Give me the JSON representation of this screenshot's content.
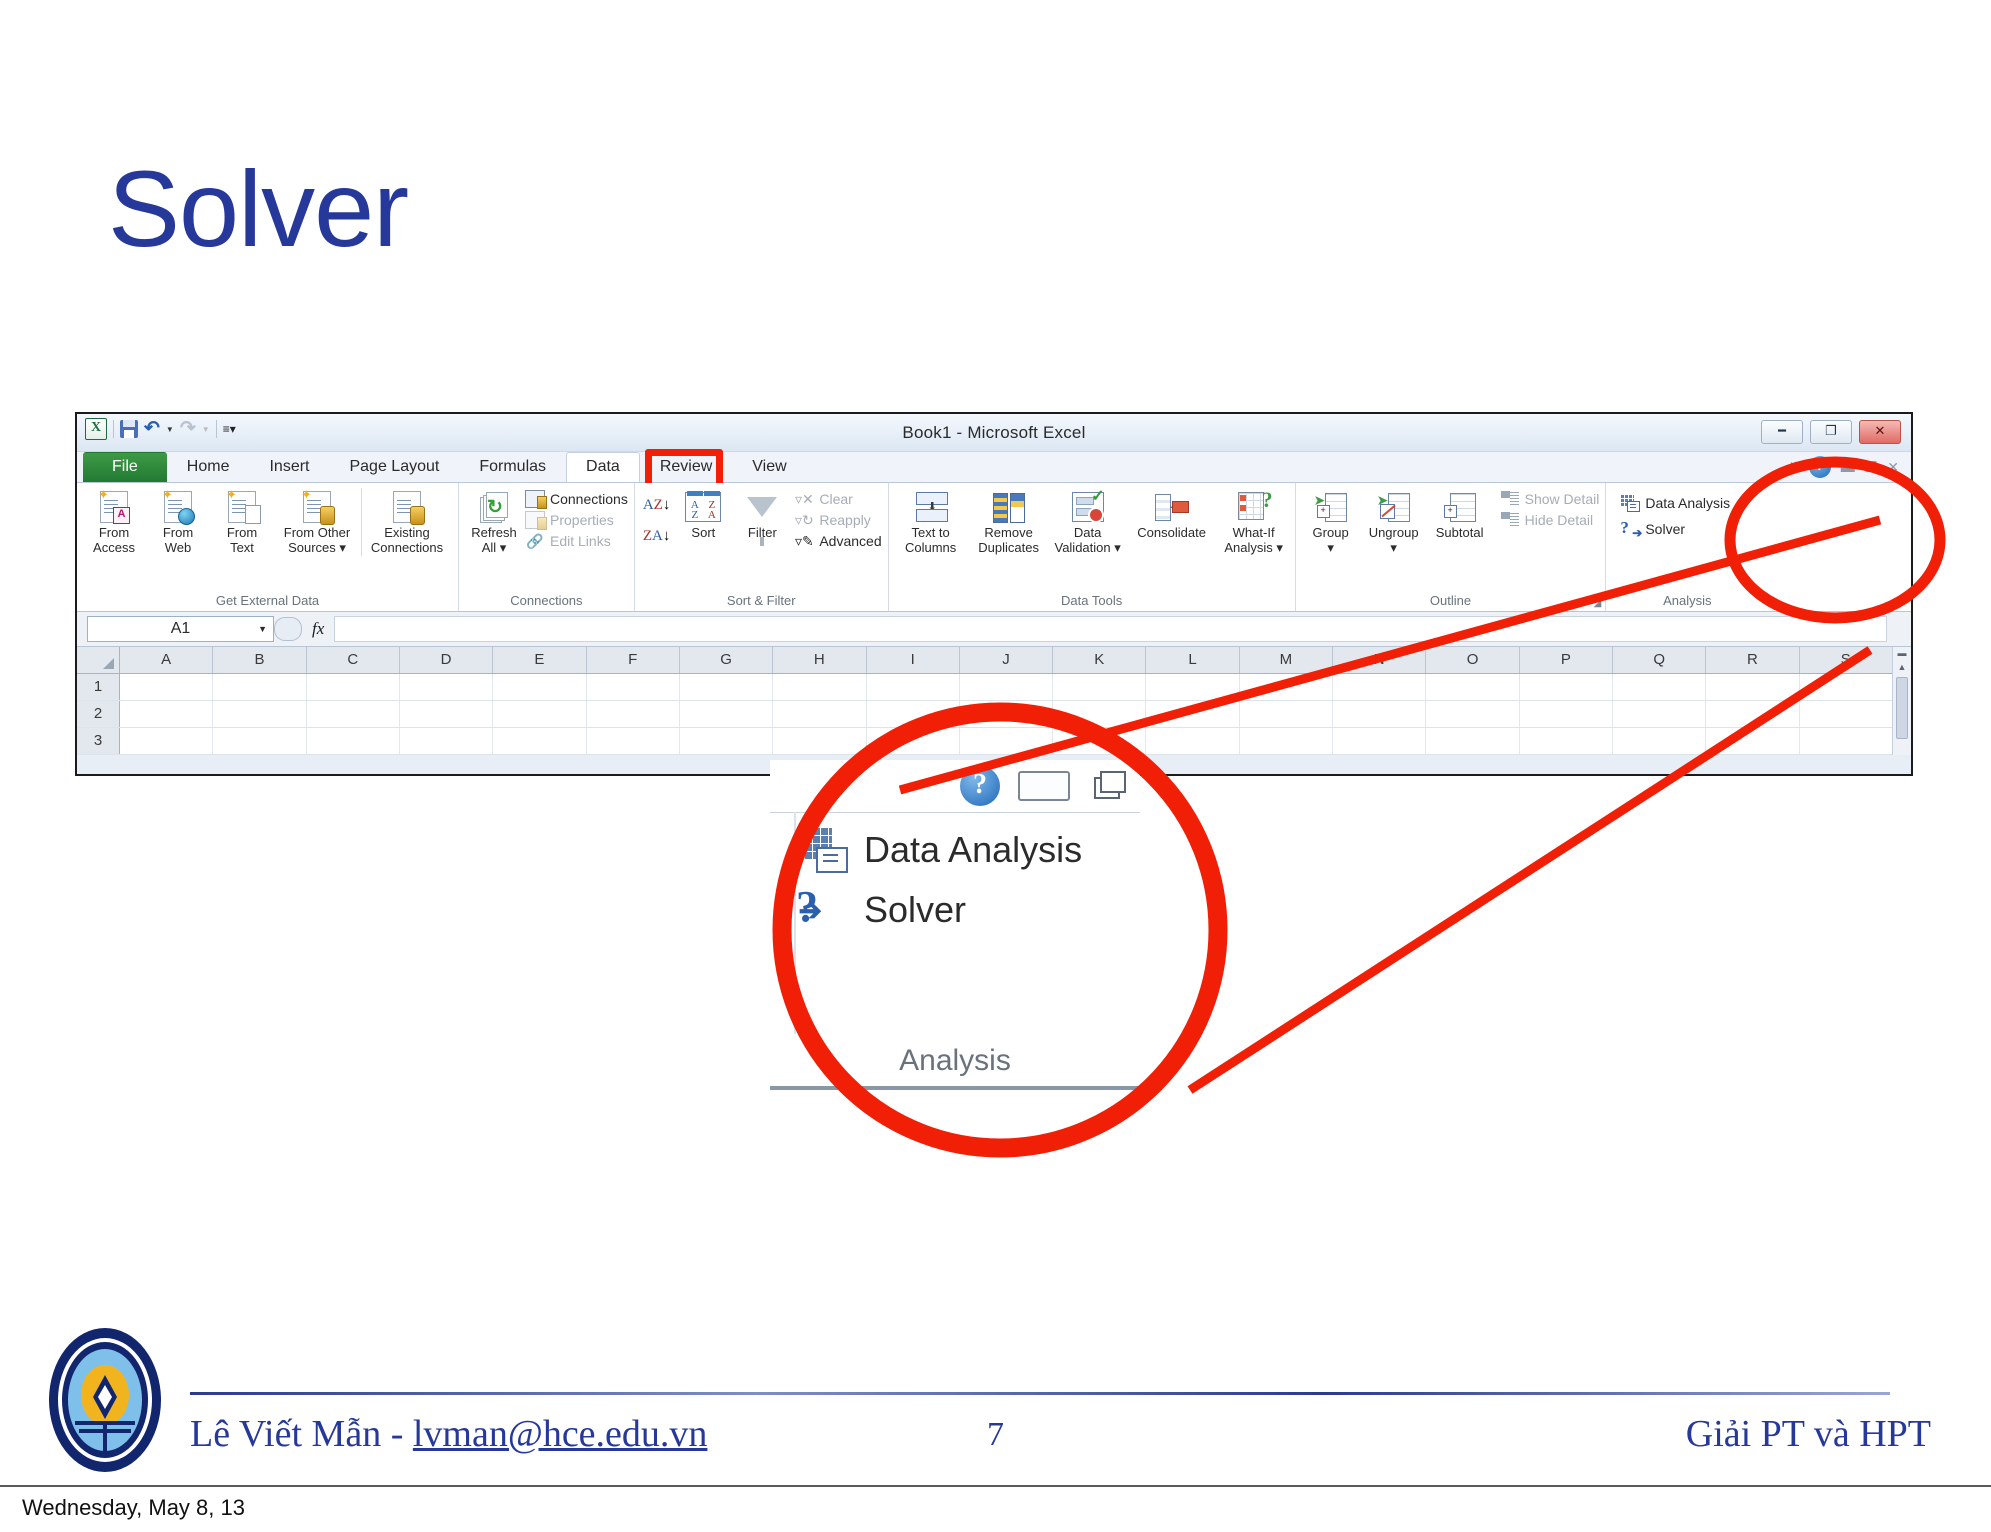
{
  "slide": {
    "title": "Solver",
    "page_number": "7",
    "footer_author": "Lê Viết Mẫn - ",
    "footer_email": "lvman@hce.edu.vn",
    "footer_right": "Giải PT và HPT",
    "date_stamp": "Wednesday, May 8, 13",
    "accent_color": "#26399b",
    "callout_color": "#f01f06"
  },
  "excel": {
    "window_title": "Book1  -  Microsoft Excel",
    "quick_access": {
      "app_logo": "excel-logo",
      "save": "save-icon",
      "undo": "undo-icon",
      "redo": "redo-icon",
      "customize": "customize-qat-icon"
    },
    "window_buttons": [
      "minimize",
      "restore",
      "close"
    ],
    "tabs": [
      {
        "label": "File",
        "state": "file"
      },
      {
        "label": "Home",
        "state": "normal"
      },
      {
        "label": "Insert",
        "state": "normal"
      },
      {
        "label": "Page Layout",
        "state": "normal"
      },
      {
        "label": "Formulas",
        "state": "normal"
      },
      {
        "label": "Data",
        "state": "active"
      },
      {
        "label": "Review",
        "state": "normal"
      },
      {
        "label": "View",
        "state": "normal"
      }
    ],
    "ribbon_groups": [
      {
        "name": "Get External Data",
        "big_buttons": [
          {
            "label": "From\nAccess",
            "icon": "from-access-icon"
          },
          {
            "label": "From\nWeb",
            "icon": "from-web-icon"
          },
          {
            "label": "From\nText",
            "icon": "from-text-icon"
          },
          {
            "label": "From Other\nSources ▾",
            "icon": "from-other-sources-icon"
          },
          {
            "label": "Existing\nConnections",
            "icon": "existing-connections-icon"
          }
        ]
      },
      {
        "name": "Connections",
        "big_buttons": [
          {
            "label": "Refresh\nAll ▾",
            "icon": "refresh-all-icon"
          }
        ],
        "small_buttons": [
          {
            "label": "Connections",
            "icon": "connections-icon",
            "disabled": false
          },
          {
            "label": "Properties",
            "icon": "properties-icon",
            "disabled": true
          },
          {
            "label": "Edit Links",
            "icon": "edit-links-icon",
            "disabled": true
          }
        ]
      },
      {
        "name": "Sort & Filter",
        "big_buttons": [
          {
            "label": "Sort",
            "icon": "sort-icon"
          },
          {
            "label": "Filter",
            "icon": "filter-icon"
          }
        ],
        "small_buttons": [
          {
            "label": "Clear",
            "icon": "clear-filter-icon",
            "disabled": true
          },
          {
            "label": "Reapply",
            "icon": "reapply-filter-icon",
            "disabled": true
          },
          {
            "label": "Advanced",
            "icon": "advanced-filter-icon",
            "disabled": false
          }
        ],
        "sort_asc": "sort-ascending-icon",
        "sort_desc": "sort-descending-icon"
      },
      {
        "name": "Data Tools",
        "big_buttons": [
          {
            "label": "Text to\nColumns",
            "icon": "text-to-columns-icon"
          },
          {
            "label": "Remove\nDuplicates",
            "icon": "remove-duplicates-icon"
          },
          {
            "label": "Data\nValidation ▾",
            "icon": "data-validation-icon"
          },
          {
            "label": "Consolidate",
            "icon": "consolidate-icon"
          },
          {
            "label": "What-If\nAnalysis ▾",
            "icon": "what-if-analysis-icon"
          }
        ]
      },
      {
        "name": "Outline",
        "big_buttons": [
          {
            "label": "Group\n▾",
            "icon": "group-icon"
          },
          {
            "label": "Ungroup\n▾",
            "icon": "ungroup-icon"
          },
          {
            "label": "Subtotal",
            "icon": "subtotal-icon"
          }
        ],
        "small_buttons": [
          {
            "label": "Show Detail",
            "icon": "show-detail-icon",
            "disabled": true
          },
          {
            "label": "Hide Detail",
            "icon": "hide-detail-icon",
            "disabled": true
          }
        ]
      },
      {
        "name": "Analysis",
        "small_buttons": [
          {
            "label": "Data Analysis",
            "icon": "data-analysis-icon",
            "disabled": false
          },
          {
            "label": "Solver",
            "icon": "solver-icon",
            "disabled": false
          }
        ]
      }
    ],
    "formula_bar": {
      "name_box": "A1",
      "fx_label": "fx",
      "formula_value": ""
    },
    "grid": {
      "columns": [
        "A",
        "B",
        "C",
        "D",
        "E",
        "F",
        "G",
        "H",
        "I",
        "J",
        "K",
        "L",
        "M",
        "N",
        "O",
        "P",
        "Q",
        "R",
        "S"
      ],
      "rows": [
        "1",
        "2",
        "3"
      ]
    }
  },
  "magnifier": {
    "items": [
      {
        "label": "Data Analysis",
        "icon": "data-analysis-icon"
      },
      {
        "label": "Solver",
        "icon": "solver-icon"
      }
    ],
    "group_name": "Analysis",
    "window_controls": [
      "help",
      "minimize",
      "restore"
    ]
  }
}
